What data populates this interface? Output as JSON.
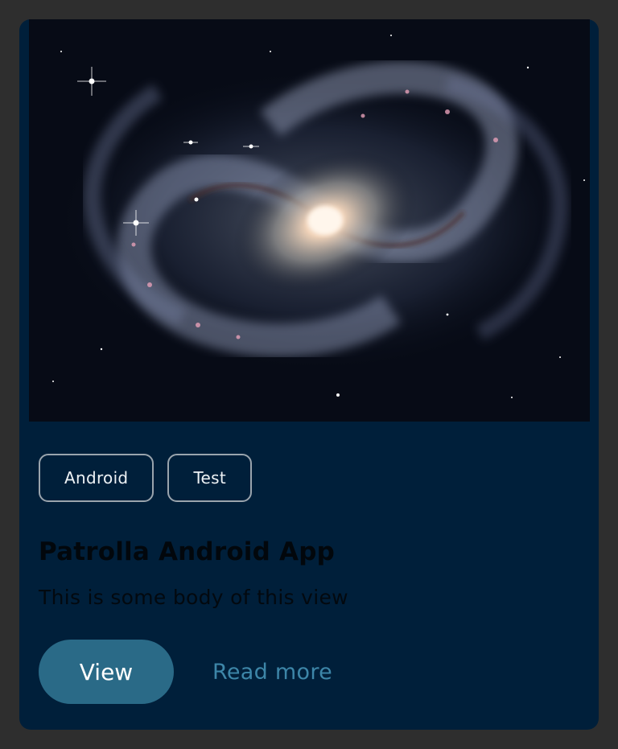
{
  "card": {
    "image": {
      "subject": "spiral galaxy",
      "icon": "galaxy-image"
    },
    "tags": [
      {
        "label": "Android"
      },
      {
        "label": "Test"
      }
    ],
    "title": "Patrolla Android App",
    "body": "This is some body of this view",
    "actions": {
      "primary_label": "View",
      "secondary_label": "Read more"
    }
  },
  "colors": {
    "page_background": "#2e2e2e",
    "card_background": "#001f3a",
    "tag_border": "#9aa4ad",
    "primary_button": "#2a6a87",
    "link": "#3d86a8"
  }
}
